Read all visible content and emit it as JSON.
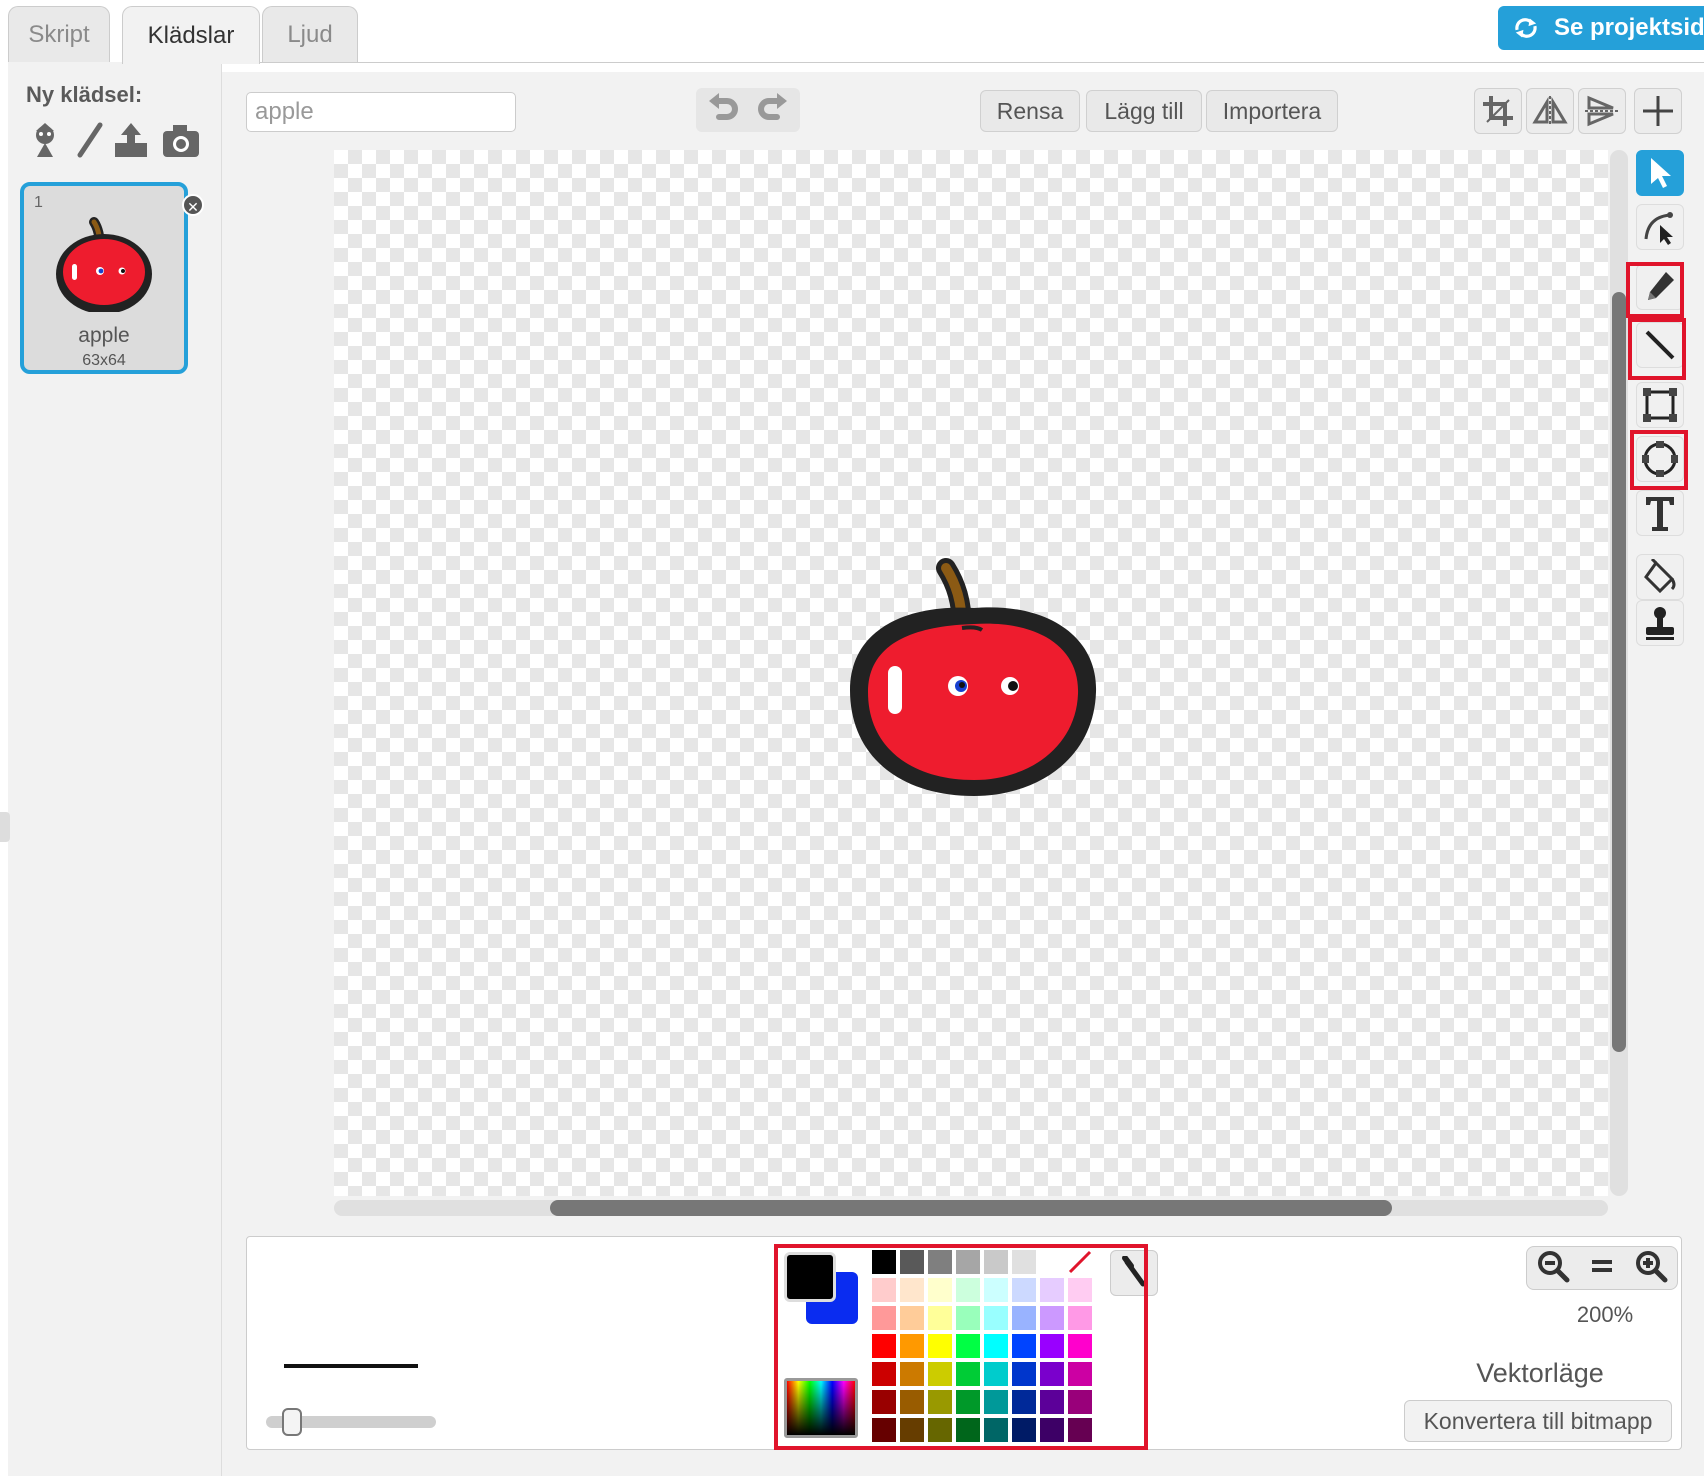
{
  "tabs": [
    {
      "label": "Skript",
      "active": false
    },
    {
      "label": "Klädslar",
      "active": true
    },
    {
      "label": "Ljud",
      "active": false
    }
  ],
  "header": {
    "see_project_label": "Se projektsida",
    "see_project_icon": "sync-arrows-icon"
  },
  "left_panel": {
    "new_costume_label": "Ny klädsel:",
    "new_costume_icons": [
      "sprite-library-icon",
      "paintbrush-icon",
      "upload-icon",
      "camera-icon"
    ],
    "costumes": [
      {
        "number": "1",
        "name": "apple",
        "size": "63x64",
        "selected": true
      }
    ]
  },
  "editor": {
    "costume_name_value": "apple",
    "buttons": {
      "clear": "Rensa",
      "add": "Lägg till",
      "import": "Importera"
    },
    "top_icons": [
      "crop-icon",
      "flip-horizontal-icon",
      "flip-vertical-icon",
      "set-center-icon"
    ],
    "tools": [
      {
        "name": "select-tool",
        "icon": "pointer-arrow-icon",
        "selected": true,
        "highlighted": false
      },
      {
        "name": "reshape-tool",
        "icon": "reshape-icon",
        "selected": false,
        "highlighted": false
      },
      {
        "name": "pencil-tool",
        "icon": "pencil-icon",
        "selected": false,
        "highlighted": true
      },
      {
        "name": "line-tool",
        "icon": "line-icon",
        "selected": false,
        "highlighted": true
      },
      {
        "name": "rectangle-tool",
        "icon": "rectangle-icon",
        "selected": false,
        "highlighted": false
      },
      {
        "name": "ellipse-tool",
        "icon": "ellipse-icon",
        "selected": false,
        "highlighted": true
      },
      {
        "name": "text-tool",
        "icon": "text-T-icon",
        "selected": false,
        "highlighted": false
      },
      {
        "name": "fill-tool",
        "icon": "paint-bucket-icon",
        "selected": false,
        "highlighted": false
      },
      {
        "name": "stamp-tool",
        "icon": "stamp-icon",
        "selected": false,
        "highlighted": false
      }
    ]
  },
  "bottom": {
    "foreground_color": "#000000",
    "background_color": "#0a2cf0",
    "palette": [
      "#000000",
      "#595959",
      "#7f7f7f",
      "#a6a6a6",
      "#c9c9c9",
      "#e0e0e0",
      "#ffffff",
      "none",
      "#ffcccc",
      "#ffe6cc",
      "#ffffcc",
      "#ccffdd",
      "#ccffff",
      "#ccd9ff",
      "#e6ccff",
      "#ffccf2",
      "#ff9999",
      "#ffcc99",
      "#ffff99",
      "#99ffbb",
      "#99ffff",
      "#99b3ff",
      "#cc99ff",
      "#ff99e6",
      "#ff0000",
      "#ff9900",
      "#ffff00",
      "#00ff44",
      "#00ffff",
      "#0044ff",
      "#9900ff",
      "#ff00cc",
      "#cc0000",
      "#cc7a00",
      "#cccc00",
      "#00cc36",
      "#00cccc",
      "#0036cc",
      "#7a00cc",
      "#cc00a3",
      "#990000",
      "#995c00",
      "#999900",
      "#009929",
      "#009999",
      "#002999",
      "#5c0099",
      "#99007a",
      "#660000",
      "#663d00",
      "#666600",
      "#00661b",
      "#006666",
      "#001b66",
      "#3d0066",
      "#660052"
    ],
    "zoom_level": "200%",
    "zoom_icons": [
      "zoom-out-icon",
      "zoom-reset-icon",
      "zoom-in-icon"
    ],
    "mode_label": "Vektorläge",
    "convert_label": "Konvertera till bitmapp"
  },
  "colors": {
    "accent": "#25a0d9",
    "highlight": "#e0142b",
    "apple_red": "#ee1c2e"
  }
}
